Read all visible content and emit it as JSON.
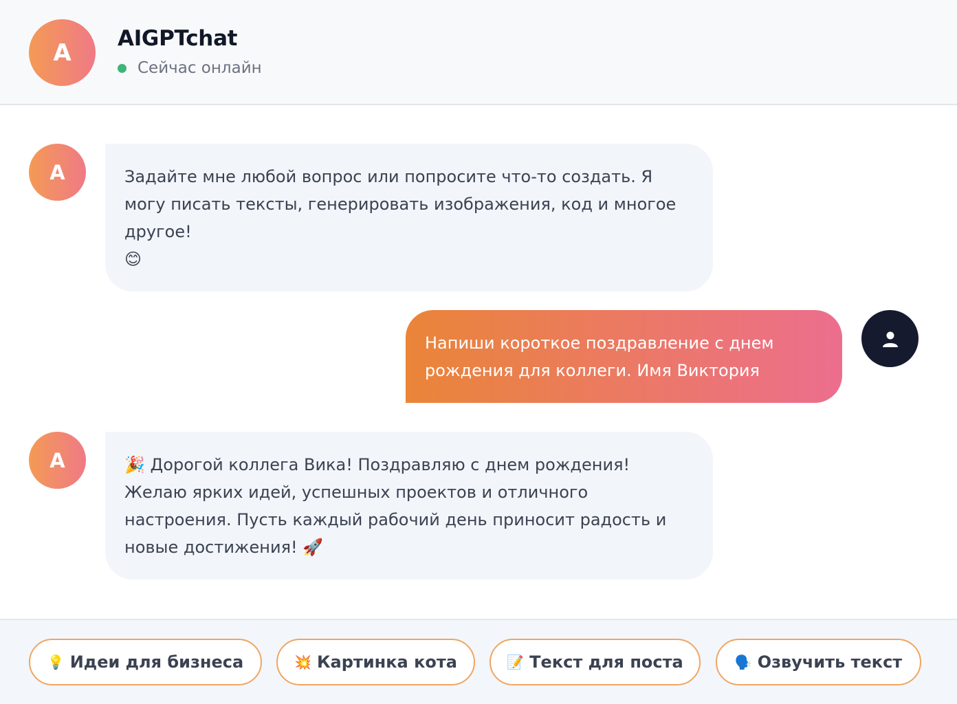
{
  "header": {
    "avatar_letter": "A",
    "title": "AIGPTchat",
    "status": "Сейчас онлайн"
  },
  "messages": [
    {
      "from": "bot",
      "avatar_letter": "A",
      "text": "Задайте мне любой вопрос или попросите что-то создать. Я могу писать тексты, генерировать изображения, код и многое другое!",
      "emoji": "😊"
    },
    {
      "from": "user",
      "avatar_icon": "user-icon",
      "text": "Напиши короткое поздравление с днем рождения для коллеги. Имя Виктория"
    },
    {
      "from": "bot",
      "avatar_letter": "A",
      "emoji_start": "🎉",
      "text": "Дорогой коллега Вика! Поздравляю с днем рождения! Желаю ярких идей, успешных проектов и отличного настроения. Пусть каждый рабочий день приносит радость и новые достижения!",
      "emoji_end": "🚀"
    }
  ],
  "suggestions": [
    {
      "icon": "💡",
      "label": "Идеи для бизнеса"
    },
    {
      "icon": "💥",
      "label": "Картинка кота"
    },
    {
      "icon": "📝",
      "label": "Текст для поста"
    },
    {
      "icon": "🗣️",
      "label": "Озвучить текст"
    }
  ],
  "colors": {
    "accent_start": "#ea8538",
    "accent_end": "#ec6e8e",
    "online": "#3fb57a",
    "chip_border": "#f0a561"
  }
}
